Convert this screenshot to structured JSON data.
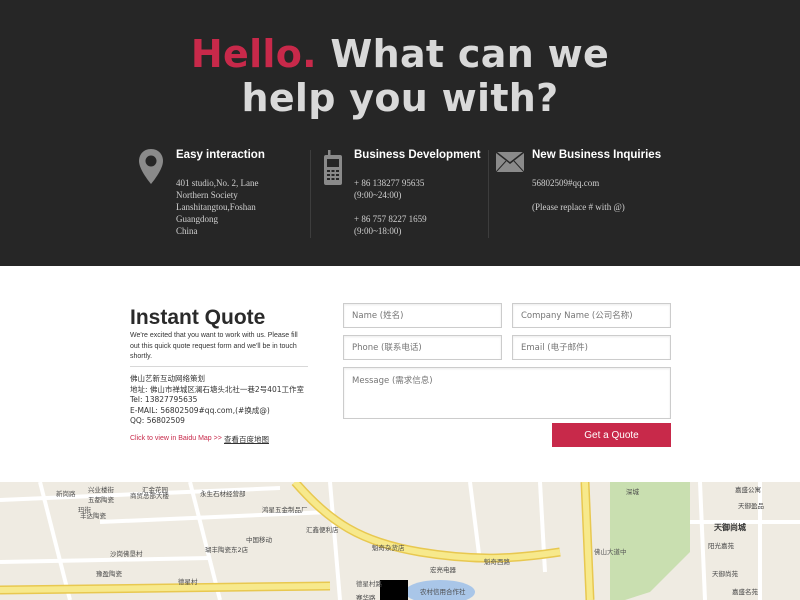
{
  "hero": {
    "title_accent": "Hello.",
    "title_rest_1": " What can we",
    "title_rest_2": "help you with?"
  },
  "contacts": [
    {
      "icon": "map-pin-icon",
      "title": "Easy interaction",
      "lines": [
        "401 studio,No. 2, Lane",
        "Northern Society",
        "Lanshitangtou,Foshan",
        "Guangdong",
        "China"
      ]
    },
    {
      "icon": "mobile-phone-icon",
      "title": "Business Development",
      "lines": [
        "+ 86 138277 95635",
        "(9:00~24:00)",
        "",
        "+ 86 757 8227 1659",
        "(9:00~18:00)"
      ]
    },
    {
      "icon": "envelope-icon",
      "title": "New Business Inquiries",
      "lines": [
        "56802509#qq.com",
        "",
        "(Please replace # with @)"
      ]
    }
  ],
  "quote": {
    "title": "Instant Quote",
    "intro": "We're excited that you want to work with us. Please fill out this quick quote request form and we'll be in touch shortly.",
    "address_lines": [
      "佛山艺新互动网络策划",
      "地址: 佛山市禅城区澜石塘头北社一巷2号401工作室",
      "Tel: 13827795635",
      "E-MAIL: 56802509#qq.com,(#换成@)",
      "QQ: 56802509"
    ],
    "map_link": "Click to view in Baidu Map >>",
    "map_link_cn": "查看百度地图",
    "placeholders": {
      "name": "Name (姓名)",
      "company": "Company Name (公司名称)",
      "phone": "Phone (联系电话)",
      "email": "Email (电子邮件)",
      "message": "Message (需求信息)"
    },
    "submit_label": "Get a Quote"
  },
  "map": {
    "labels": [
      "新岗路",
      "兴业楼街",
      "五都陶瓷",
      "玛街",
      "丰达陶瓷",
      "商贸总部大楼",
      "汇金花园",
      "永生石材经营部",
      "沙岗佛垦村",
      "瑚丰陶瓷东2店",
      "中国移动",
      "豫盈陶瓷",
      "德星村",
      "汇鑫便利店",
      "魁奇杂货店",
      "鸿星五金制品厂",
      "德星村路",
      "宏亮电器",
      "魁奇西路",
      "农村信用合作社",
      "佛山大道中",
      "嘉盛公寓",
      "天御盈品",
      "天御尚城",
      "阳光嘉苑",
      "天御尚苑",
      "赛华路",
      "嘉盛名苑",
      "深城"
    ]
  },
  "colors": {
    "accent": "#c8294a",
    "hero_bg": "#262626",
    "map_bg": "#efebe2",
    "road_yellow": "#f5e07a"
  }
}
